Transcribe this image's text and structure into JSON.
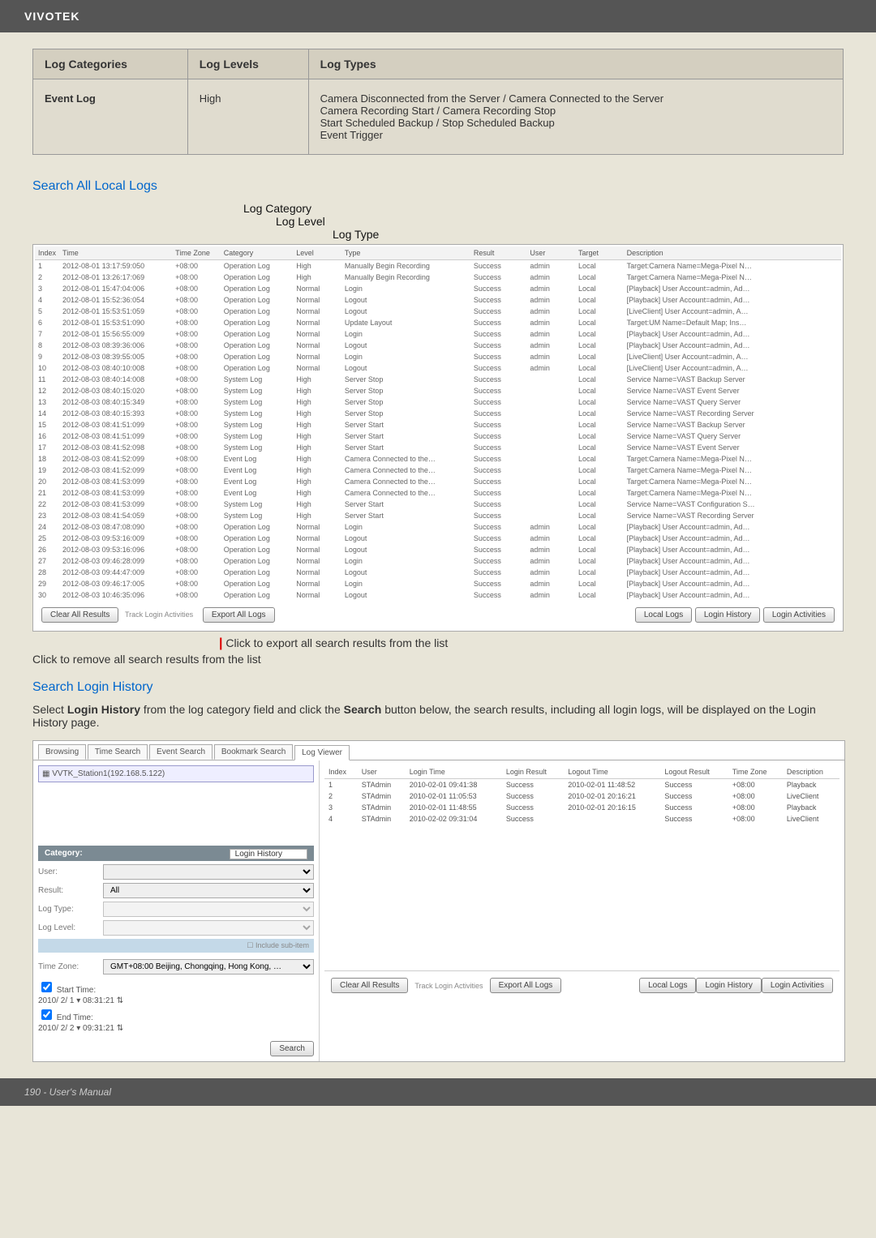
{
  "header": {
    "brand": "VIVOTEK"
  },
  "categories_table": {
    "headers": [
      "Log Categories",
      "Log Levels",
      "Log Types"
    ],
    "row": {
      "category": "Event Log",
      "level": "High",
      "types": "Camera Disconnected from the Server / Camera Connected to the Server\nCamera Recording Start / Camera Recording Stop\nStart Scheduled Backup / Stop Scheduled Backup\nEvent Trigger"
    }
  },
  "section1": {
    "title": "Search All Local Logs",
    "labels": {
      "l1": "Log Category",
      "l2": "Log Level",
      "l3": "Log Type"
    },
    "clear_btn": "Clear All Results",
    "export_btn": "Export All Logs",
    "right_btns": {
      "local": "Local Logs",
      "history": "Login History",
      "activities": "Login Activities"
    },
    "export_note": "Click to export all search results from the list",
    "remove_note": "Click to remove all search results from the list"
  },
  "log_table": {
    "headers": [
      "Index",
      "Time",
      "Time Zone",
      "Category",
      "Level",
      "Type",
      "Result",
      "User",
      "Target",
      "Description"
    ],
    "rows": [
      [
        "1",
        "2012-08-01 13:17:59:050",
        "+08:00",
        "Operation Log",
        "High",
        "Manually Begin Recording",
        "Success",
        "admin",
        "Local",
        "Target:Camera Name=Mega-Pixel N…"
      ],
      [
        "2",
        "2012-08-01 13:26:17:069",
        "+08:00",
        "Operation Log",
        "High",
        "Manually Begin Recording",
        "Success",
        "admin",
        "Local",
        "Target:Camera Name=Mega-Pixel N…"
      ],
      [
        "3",
        "2012-08-01 15:47:04:006",
        "+08:00",
        "Operation Log",
        "Normal",
        "Login",
        "Success",
        "admin",
        "Local",
        "[Playback] User Account=admin, Ad…"
      ],
      [
        "4",
        "2012-08-01 15:52:36:054",
        "+08:00",
        "Operation Log",
        "Normal",
        "Logout",
        "Success",
        "admin",
        "Local",
        "[Playback] User Account=admin, Ad…"
      ],
      [
        "5",
        "2012-08-01 15:53:51:059",
        "+08:00",
        "Operation Log",
        "Normal",
        "Logout",
        "Success",
        "admin",
        "Local",
        "[LiveClient] User Account=admin, A…"
      ],
      [
        "6",
        "2012-08-01 15:53:51:090",
        "+08:00",
        "Operation Log",
        "Normal",
        "Update Layout",
        "Success",
        "admin",
        "Local",
        "Target:UM Name=Default Map; Ins…"
      ],
      [
        "7",
        "2012-08-01 15:56:55:009",
        "+08:00",
        "Operation Log",
        "Normal",
        "Login",
        "Success",
        "admin",
        "Local",
        "[Playback] User Account=admin, Ad…"
      ],
      [
        "8",
        "2012-08-03 08:39:36:006",
        "+08:00",
        "Operation Log",
        "Normal",
        "Logout",
        "Success",
        "admin",
        "Local",
        "[Playback] User Account=admin, Ad…"
      ],
      [
        "9",
        "2012-08-03 08:39:55:005",
        "+08:00",
        "Operation Log",
        "Normal",
        "Login",
        "Success",
        "admin",
        "Local",
        "[LiveClient] User Account=admin, A…"
      ],
      [
        "10",
        "2012-08-03 08:40:10:008",
        "+08:00",
        "Operation Log",
        "Normal",
        "Logout",
        "Success",
        "admin",
        "Local",
        "[LiveClient] User Account=admin, A…"
      ],
      [
        "11",
        "2012-08-03 08:40:14:008",
        "+08:00",
        "System Log",
        "High",
        "Server Stop",
        "Success",
        "",
        "Local",
        "Service Name=VAST Backup Server"
      ],
      [
        "12",
        "2012-08-03 08:40:15:020",
        "+08:00",
        "System Log",
        "High",
        "Server Stop",
        "Success",
        "",
        "Local",
        "Service Name=VAST Event Server"
      ],
      [
        "13",
        "2012-08-03 08:40:15:349",
        "+08:00",
        "System Log",
        "High",
        "Server Stop",
        "Success",
        "",
        "Local",
        "Service Name=VAST Query Server"
      ],
      [
        "14",
        "2012-08-03 08:40:15:393",
        "+08:00",
        "System Log",
        "High",
        "Server Stop",
        "Success",
        "",
        "Local",
        "Service Name=VAST Recording Server"
      ],
      [
        "15",
        "2012-08-03 08:41:51:099",
        "+08:00",
        "System Log",
        "High",
        "Server Start",
        "Success",
        "",
        "Local",
        "Service Name=VAST Backup Server"
      ],
      [
        "16",
        "2012-08-03 08:41:51:099",
        "+08:00",
        "System Log",
        "High",
        "Server Start",
        "Success",
        "",
        "Local",
        "Service Name=VAST Query Server"
      ],
      [
        "17",
        "2012-08-03 08:41:52:098",
        "+08:00",
        "System Log",
        "High",
        "Server Start",
        "Success",
        "",
        "Local",
        "Service Name=VAST Event Server"
      ],
      [
        "18",
        "2012-08-03 08:41:52:099",
        "+08:00",
        "Event Log",
        "High",
        "Camera Connected to the…",
        "Success",
        "",
        "Local",
        "Target:Camera Name=Mega-Pixel N…"
      ],
      [
        "19",
        "2012-08-03 08:41:52:099",
        "+08:00",
        "Event Log",
        "High",
        "Camera Connected to the…",
        "Success",
        "",
        "Local",
        "Target:Camera Name=Mega-Pixel N…"
      ],
      [
        "20",
        "2012-08-03 08:41:53:099",
        "+08:00",
        "Event Log",
        "High",
        "Camera Connected to the…",
        "Success",
        "",
        "Local",
        "Target:Camera Name=Mega-Pixel N…"
      ],
      [
        "21",
        "2012-08-03 08:41:53:099",
        "+08:00",
        "Event Log",
        "High",
        "Camera Connected to the…",
        "Success",
        "",
        "Local",
        "Target:Camera Name=Mega-Pixel N…"
      ],
      [
        "22",
        "2012-08-03 08:41:53:099",
        "+08:00",
        "System Log",
        "High",
        "Server Start",
        "Success",
        "",
        "Local",
        "Service Name=VAST Configuration S…"
      ],
      [
        "23",
        "2012-08-03 08:41:54:059",
        "+08:00",
        "System Log",
        "High",
        "Server Start",
        "Success",
        "",
        "Local",
        "Service Name=VAST Recording Server"
      ],
      [
        "24",
        "2012-08-03 08:47:08:090",
        "+08:00",
        "Operation Log",
        "Normal",
        "Login",
        "Success",
        "admin",
        "Local",
        "[Playback] User Account=admin, Ad…"
      ],
      [
        "25",
        "2012-08-03 09:53:16:009",
        "+08:00",
        "Operation Log",
        "Normal",
        "Logout",
        "Success",
        "admin",
        "Local",
        "[Playback] User Account=admin, Ad…"
      ],
      [
        "26",
        "2012-08-03 09:53:16:096",
        "+08:00",
        "Operation Log",
        "Normal",
        "Logout",
        "Success",
        "admin",
        "Local",
        "[Playback] User Account=admin, Ad…"
      ],
      [
        "27",
        "2012-08-03 09:46:28:099",
        "+08:00",
        "Operation Log",
        "Normal",
        "Login",
        "Success",
        "admin",
        "Local",
        "[Playback] User Account=admin, Ad…"
      ],
      [
        "28",
        "2012-08-03 09:44:47:009",
        "+08:00",
        "Operation Log",
        "Normal",
        "Logout",
        "Success",
        "admin",
        "Local",
        "[Playback] User Account=admin, Ad…"
      ],
      [
        "29",
        "2012-08-03 09:46:17:005",
        "+08:00",
        "Operation Log",
        "Normal",
        "Login",
        "Success",
        "admin",
        "Local",
        "[Playback] User Account=admin, Ad…"
      ],
      [
        "30",
        "2012-08-03 10:46:35:096",
        "+08:00",
        "Operation Log",
        "Normal",
        "Logout",
        "Success",
        "admin",
        "Local",
        "[Playback] User Account=admin, Ad…"
      ]
    ]
  },
  "section2": {
    "title": "Search Login History",
    "body": "Select Login History from the log category field and click the Search button below, the search results, including all login logs, will be displayed on the Login History page."
  },
  "login_screenshot": {
    "tabs": [
      "Browsing",
      "Time Search",
      "Event Search",
      "Bookmark Search",
      "Log Viewer"
    ],
    "station": "VVTK_Station1(192.168.5.122)",
    "category_label": "Category:",
    "category_value": "Login History",
    "form": {
      "user": {
        "label": "User:",
        "value": ""
      },
      "result": {
        "label": "Result:",
        "value": "All"
      },
      "logtype": {
        "label": "Log Type:",
        "value": ""
      },
      "loglevel": {
        "label": "Log Level:",
        "value": ""
      }
    },
    "timezone": {
      "label": "Time Zone:",
      "value": "GMT+08:00 Beijing, Chongqing, Hong Kong, …"
    },
    "start": {
      "check": "Start Time:",
      "value": "2010/ 2/ 1 ▾  08:31:21 ⇅"
    },
    "end": {
      "check": "End Time:",
      "value": "2010/ 2/ 2 ▾  09:31:21 ⇅"
    },
    "search_btn": "Search",
    "login_table": {
      "headers": [
        "Index",
        "User",
        "Login Time",
        "Login Result",
        "Logout Time",
        "Logout Result",
        "Time Zone",
        "Description"
      ],
      "rows": [
        [
          "1",
          "STAdmin",
          "2010-02-01 09:41:38",
          "Success",
          "2010-02-01 11:48:52",
          "Success",
          "+08:00",
          "Playback"
        ],
        [
          "2",
          "STAdmin",
          "2010-02-01 11:05:53",
          "Success",
          "2010-02-01 20:16:21",
          "Success",
          "+08:00",
          "LiveClient"
        ],
        [
          "3",
          "STAdmin",
          "2010-02-01 11:48:55",
          "Success",
          "2010-02-01 20:16:15",
          "Success",
          "+08:00",
          "Playback"
        ],
        [
          "4",
          "STAdmin",
          "2010-02-02 09:31:04",
          "Success",
          "",
          "Success",
          "+08:00",
          "LiveClient"
        ]
      ]
    },
    "bottom": {
      "clear": "Clear All Results",
      "export": "Export All Logs",
      "rlocal": "Local Logs",
      "rhistory": "Login History",
      "ractivities": "Login Activities"
    }
  },
  "footer": {
    "text": "190 - User's Manual"
  }
}
